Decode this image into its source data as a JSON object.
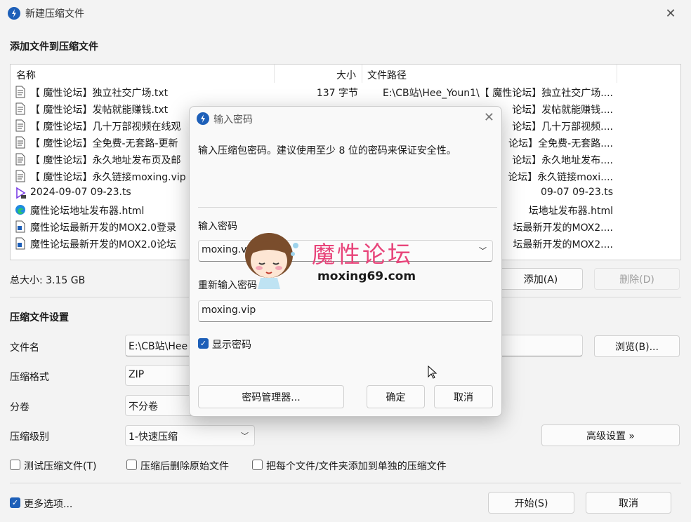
{
  "window": {
    "title": "新建压缩文件"
  },
  "section_files": "添加文件到压缩文件",
  "file_list": {
    "headers": {
      "name": "名称",
      "size": "大小",
      "path": "文件路径"
    },
    "rows": [
      {
        "name": "【 魔性论坛】独立社交广场.txt",
        "size": "137 字节",
        "path": "E:\\CB站\\Hee_Youn1\\【 魔性论坛】独立社交广场....",
        "icon": "text-file-icon"
      },
      {
        "name": "【 魔性论坛】发帖就能赚钱.txt",
        "size": "",
        "path": "论坛】发帖就能赚钱....",
        "icon": "text-file-icon"
      },
      {
        "name": "【 魔性论坛】几十万部视频在线观",
        "size": "",
        "path": "论坛】几十万部视频....",
        "icon": "text-file-icon"
      },
      {
        "name": "【 魔性论坛】全免费-无套路-更新",
        "size": "",
        "path": "论坛】全免费-无套路....",
        "icon": "text-file-icon"
      },
      {
        "name": "【 魔性论坛】永久地址发布页及邮",
        "size": "",
        "path": "论坛】永久地址发布....",
        "icon": "text-file-icon"
      },
      {
        "name": "【 魔性论坛】永久链接moxing.vip",
        "size": "",
        "path": "论坛】永久链接moxi....",
        "icon": "text-file-icon"
      },
      {
        "name": "2024-09-07 09-23.ts",
        "size": "",
        "path": "09-07 09-23.ts",
        "icon": "video-file-icon"
      },
      {
        "name": "魔性论坛地址发布器.html",
        "size": "",
        "path": "坛地址发布器.html",
        "icon": "edge-html-icon"
      },
      {
        "name": "魔性论坛最新开发的MOX2.0登录",
        "size": "",
        "path": "坛最新开发的MOX2....",
        "icon": "word-doc-icon"
      },
      {
        "name": "魔性论坛最新开发的MOX2.0论坛",
        "size": "",
        "path": "坛最新开发的MOX2....",
        "icon": "word-doc-icon"
      }
    ]
  },
  "total_size": "总大小: 3.15 GB",
  "add_button": "添加(A)",
  "delete_button": "删除(D)",
  "section_settings": "压缩文件设置",
  "settings": {
    "filename_label": "文件名",
    "filename_value": "E:\\CB站\\Hee",
    "browse_button": "浏览(B)...",
    "format_label": "压缩格式",
    "format_value": "ZIP",
    "volume_label": "分卷",
    "volume_value": "不分卷",
    "level_label": "压缩级别",
    "level_value": "1-快速压缩",
    "advanced_button": "高级设置 »"
  },
  "options": {
    "test": "测试压缩文件(T)",
    "delete_after": "压缩后删除原始文件",
    "each_separate": "把每个文件/文件夹添加到单独的压缩文件",
    "more": "更多选项..."
  },
  "start_button": "开始(S)",
  "cancel_button": "取消",
  "dialog": {
    "title": "输入密码",
    "description": "输入压缩包密码。建议使用至少 8 位的密码来保证安全性。",
    "password_label": "输入密码",
    "password_value": "moxing.vi",
    "confirm_label": "重新输入密码",
    "confirm_value": "moxing.vip",
    "show_password": "显示密码",
    "manager_button": "密码管理器...",
    "ok_button": "确定",
    "cancel_button": "取消"
  },
  "watermark": {
    "title": "魔性论坛",
    "url": "moxing69.com"
  },
  "colors": {
    "accent": "#1d5fb8",
    "watermark": "#e8447a"
  }
}
